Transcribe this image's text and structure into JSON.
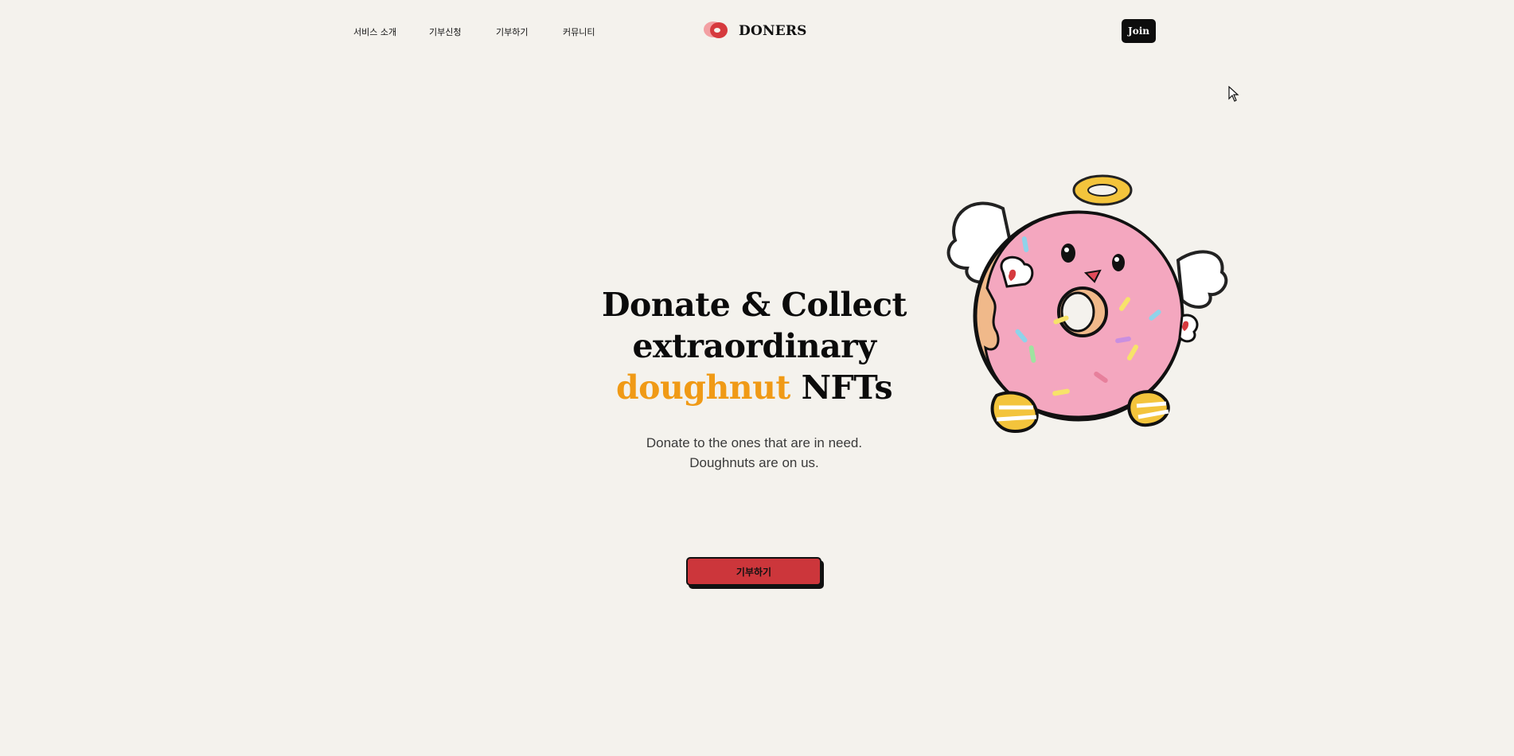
{
  "nav": {
    "items": [
      {
        "label": "서비스 소개"
      },
      {
        "label": "기부신청"
      },
      {
        "label": "기부하기"
      },
      {
        "label": "커뮤니티"
      }
    ]
  },
  "logo": {
    "text": "DONERS",
    "icon": "doughnut-logo-icon"
  },
  "header": {
    "join_label": "Join"
  },
  "hero": {
    "title_line1": "Donate & Collect",
    "title_line2": "extraordinary",
    "title_accent": "doughnut",
    "title_line3_rest": "NFTs",
    "subtitle_line1": "Donate to the ones that are in need.",
    "subtitle_line2": "Doughnuts are on us.",
    "cta_label": "기부하기",
    "illustration": "angel-doughnut-mascot"
  },
  "colors": {
    "background": "#f4f2ed",
    "accent": "#f09a16",
    "cta": "#cc363b",
    "dark": "#0d0d0d"
  }
}
